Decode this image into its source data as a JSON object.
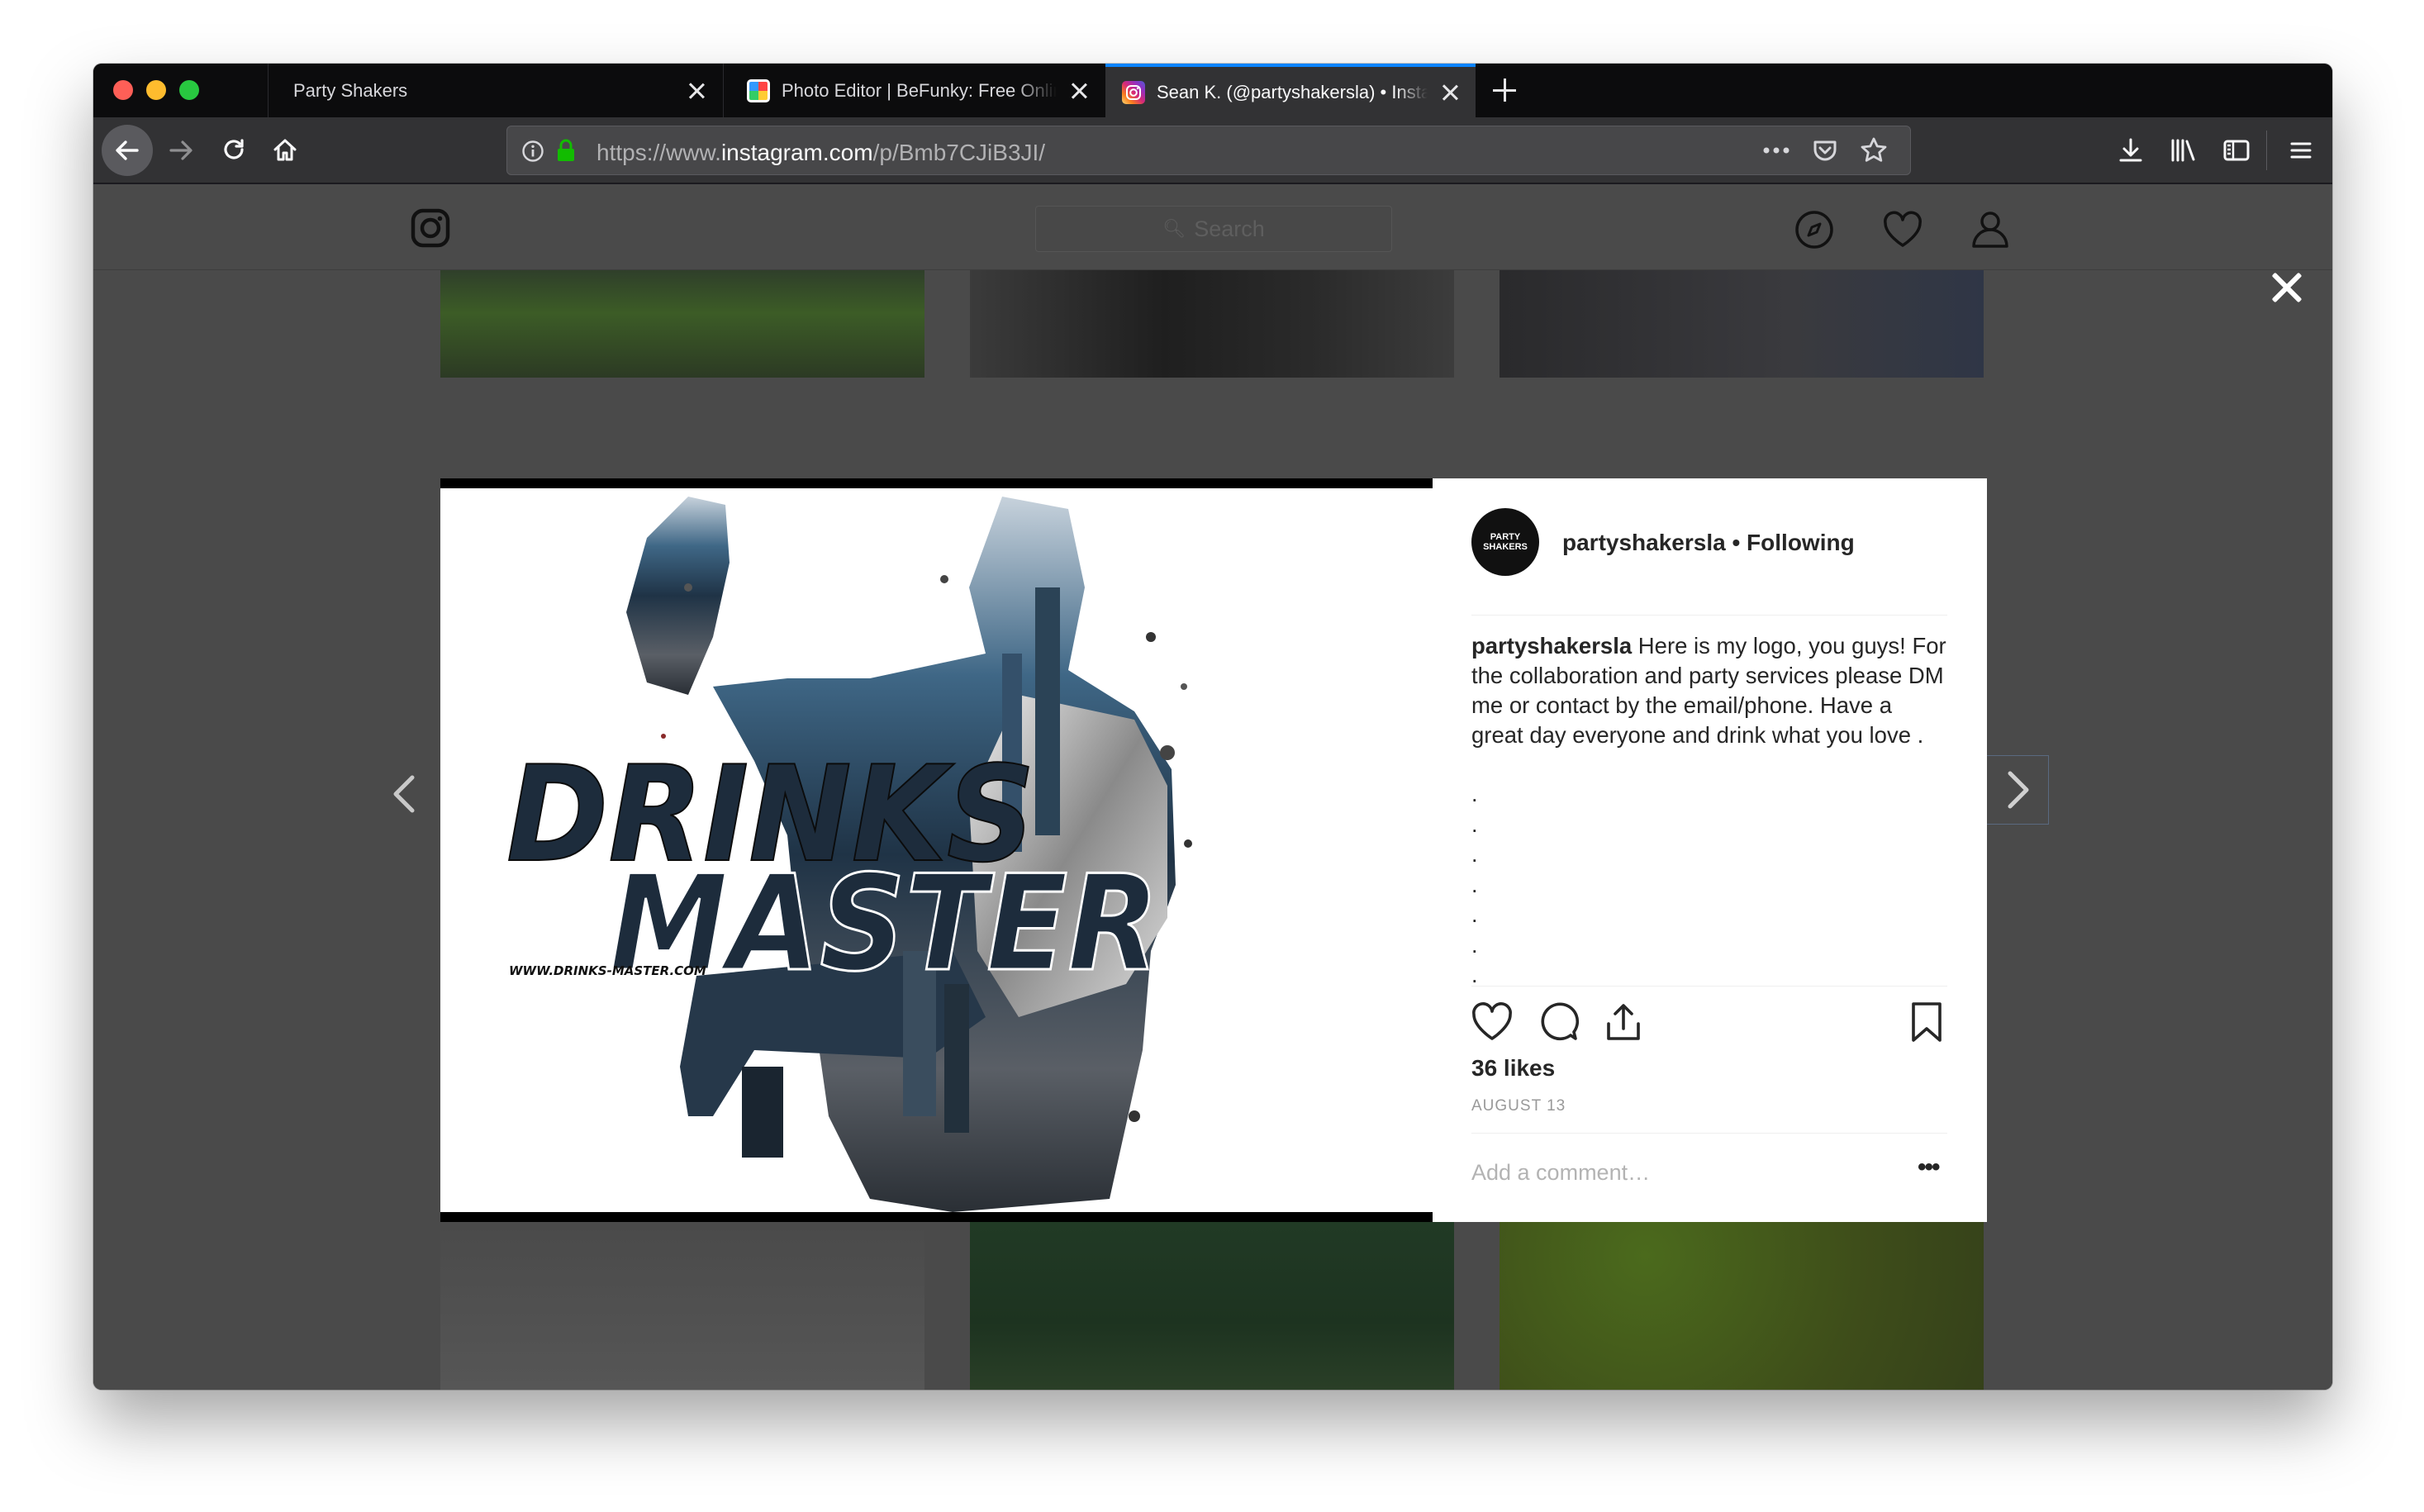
{
  "browser": {
    "tabs": [
      {
        "title": "Party Shakers",
        "active": false,
        "favicon": "none"
      },
      {
        "title": "Photo Editor | BeFunky: Free Online",
        "active": false,
        "favicon": "befunky-icon"
      },
      {
        "title": "Sean K. (@partyshakersla) • Instagram",
        "active": true,
        "favicon": "instagram-icon"
      }
    ],
    "url": {
      "prefix": "https://www.",
      "domain": "instagram.com",
      "path": "/p/Bmb7CJiB3JI/"
    },
    "accent_color": "#0a84ff"
  },
  "instagram": {
    "search_placeholder": "Search",
    "post": {
      "image_text": {
        "line1": "DRINKS",
        "line2": "MASTER",
        "website": "WWW.DRINKS-MASTER.COM"
      },
      "avatar_text": "PARTY SHAKERS",
      "username": "partyshakersla",
      "follow_status": "• Following",
      "caption_user": "partyshakersla",
      "caption_text": "Here is my logo, you guys! For the collaboration and party services please DM me or contact by the email/phone. Have a great day everyone and drink what you love .",
      "caption_dots": [
        ".",
        ".",
        ".",
        ".",
        ".",
        ".",
        "."
      ],
      "likes": "36 likes",
      "date": "AUGUST 13",
      "comment_placeholder": "Add a comment…",
      "more_label": "•••"
    }
  }
}
